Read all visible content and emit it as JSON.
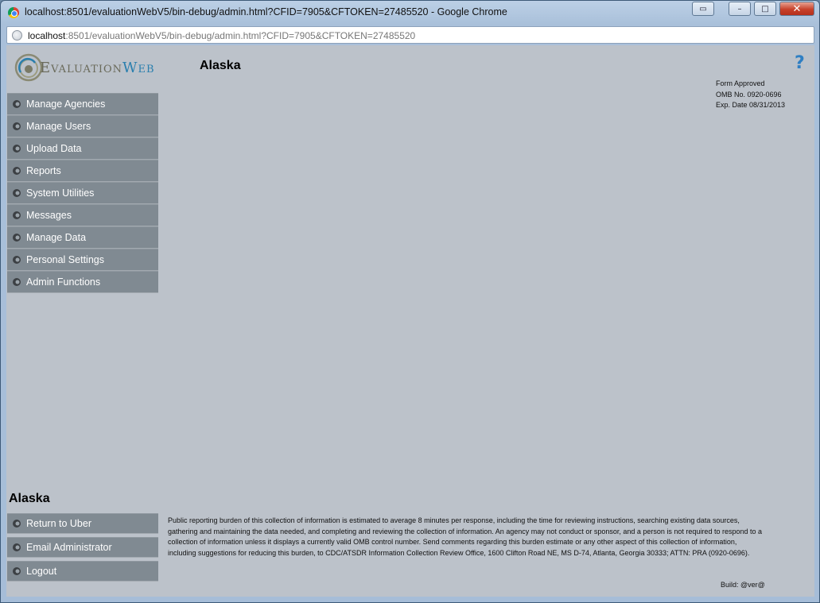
{
  "window": {
    "title": "localhost:8501/evaluationWebV5/bin-debug/admin.html?CFID=7905&CFTOKEN=27485520 - Google Chrome",
    "controls": {
      "group": "▭",
      "minimize": "–",
      "maximize": "□",
      "close": "✕"
    }
  },
  "address_bar": {
    "host": "localhost",
    "path": ":8501/evaluationWebV5/bin-debug/admin.html?CFID=7905&CFTOKEN=27485520"
  },
  "header": {
    "logo_first": "Evaluation",
    "logo_second": "Web",
    "state": "Alaska",
    "help": "?"
  },
  "omb": {
    "line1": "Form Approved",
    "line2": "OMB No. 0920-0696",
    "line3": "Exp. Date 08/31/2013"
  },
  "nav": {
    "items": [
      {
        "label": "Manage Agencies"
      },
      {
        "label": "Manage Users"
      },
      {
        "label": "Upload Data"
      },
      {
        "label": "Reports"
      },
      {
        "label": "System Utilities"
      },
      {
        "label": "Messages"
      },
      {
        "label": "Manage Data"
      },
      {
        "label": "Personal Settings"
      },
      {
        "label": "Admin Functions"
      }
    ]
  },
  "footer": {
    "state": "Alaska",
    "items": [
      {
        "label": "Return to Uber"
      },
      {
        "label": "Email Administrator"
      },
      {
        "label": "Logout"
      }
    ],
    "disclaimer": "Public reporting burden of this collection of information is estimated to average 8 minutes per response, including the time for reviewing instructions, searching existing data sources, gathering and maintaining the data needed, and completing and reviewing the collection of information.  An agency may not conduct or sponsor, and a person is not required to respond to a collection of information unless it displays a currently valid OMB control number.  Send comments regarding this burden estimate or any other aspect of this collection of information, including suggestions for reducing this burden, to CDC/ATSDR Information Collection Review Office, 1600 Clifton Road NE, MS D-74, Atlanta, Georgia 30333; ATTN: PRA (0920-0696).",
    "build": "Build:  @ver@"
  },
  "colors": {
    "nav_bg": "#808a92",
    "content_bg": "#bcc2ca",
    "help": "#2f7fc3",
    "logo_web": "#2a7fae"
  }
}
